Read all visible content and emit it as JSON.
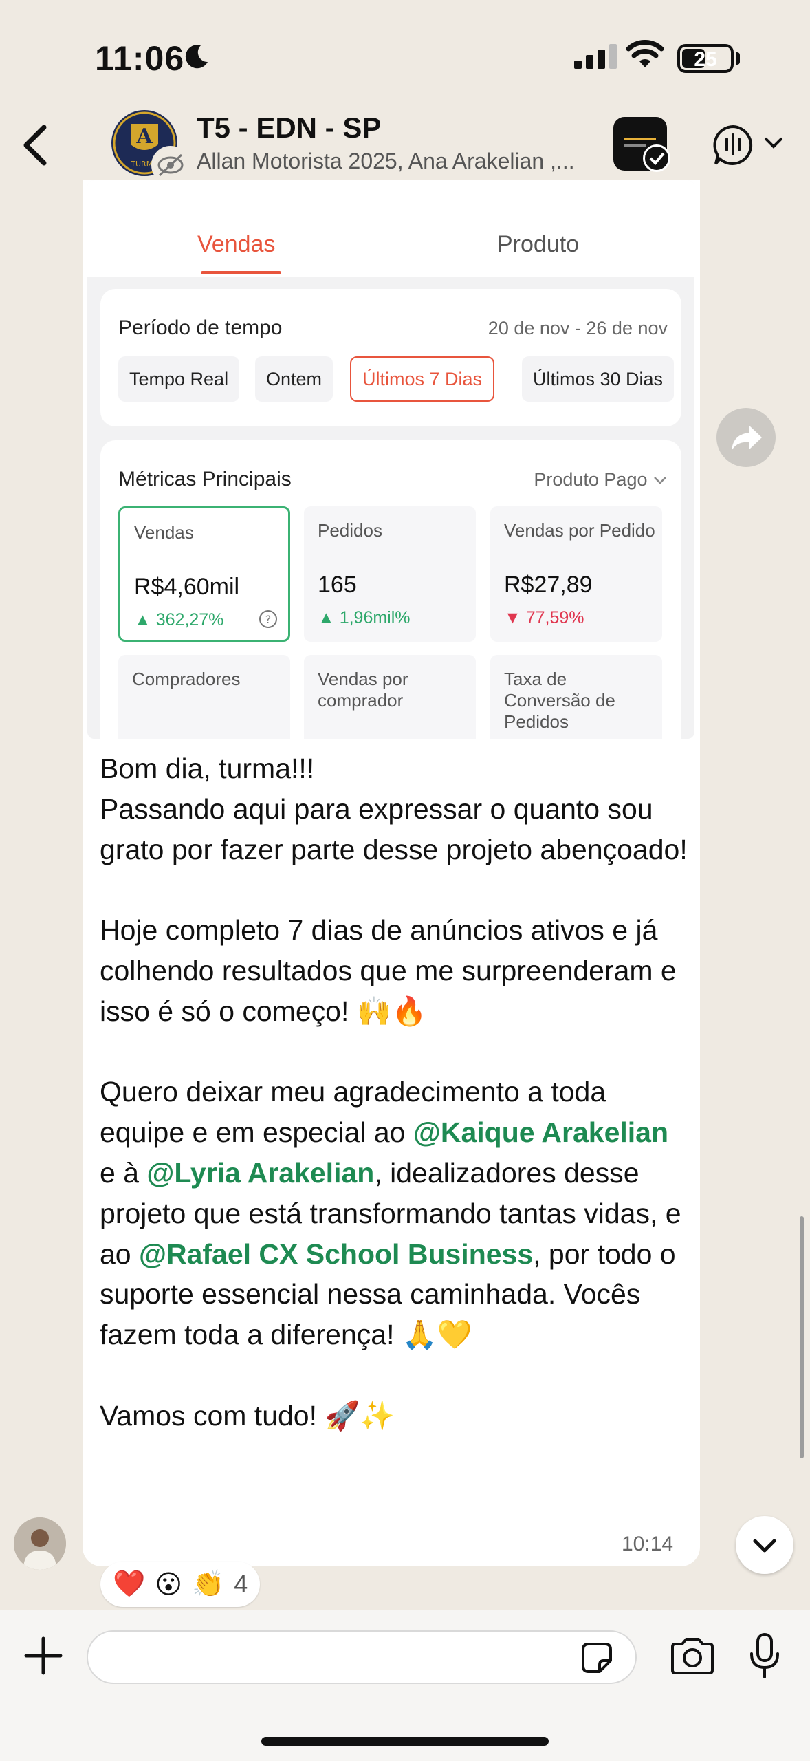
{
  "status": {
    "time": "11:06",
    "battery": "25",
    "battery_level": 0.25
  },
  "header": {
    "title": "T5 - EDN - SP",
    "subtitle": "Allan Motorista 2025, Ana Arakelian ,...",
    "avatar_letter": "A",
    "avatar_caption": "TURMA"
  },
  "message": {
    "screenshot": {
      "tabs": [
        "Vendas",
        "Produto"
      ],
      "period": {
        "title": "Período de tempo",
        "range": "20 de nov - 26 de nov",
        "chips": [
          "Tempo Real",
          "Ontem",
          "Últimos 7 Dias",
          "Últimos 30 Dias"
        ]
      },
      "metrics": {
        "title": "Métricas Principais",
        "filter": "Produto Pago",
        "items": [
          {
            "label": "Vendas",
            "value": "R$4,60mil",
            "delta": "362,27%"
          },
          {
            "label": "Pedidos",
            "value": "165",
            "delta": "1,96mil%"
          },
          {
            "label": "Vendas por Pedido",
            "value": "R$27,89",
            "delta": "77,59%"
          },
          {
            "label": "Compradores"
          },
          {
            "label": "Vendas por comprador"
          },
          {
            "label": "Taxa de Conversão de Pedidos"
          }
        ]
      }
    },
    "text": {
      "p1": "Bom dia, turma!!!\nPassando aqui para expressar o quanto sou grato por fazer parte desse projeto abençoado!",
      "p2": "Hoje completo 7 dias de anúncios ativos e já colhendo resultados que me surpreenderam e isso é só o começo! 🙌🔥",
      "p3a": "Quero deixar meu agradecimento a toda equipe e em especial ao ",
      "m1": "@Kaique Arakelian",
      "p3b": " e à ",
      "m2": "@Lyria Arakelian",
      "p3c": ", idealizadores desse projeto que está transformando tantas vidas, e ao ",
      "m3": "@Rafael CX School Business",
      "p3d": ", por todo o suporte essencial nessa caminhada. Vocês fazem toda a diferença! 🙏💛",
      "p4": "Vamos com tudo! 🚀✨"
    },
    "time": "10:14",
    "reactions": {
      "emojis": [
        "❤️",
        "😮",
        "👏"
      ],
      "count": "4"
    }
  }
}
